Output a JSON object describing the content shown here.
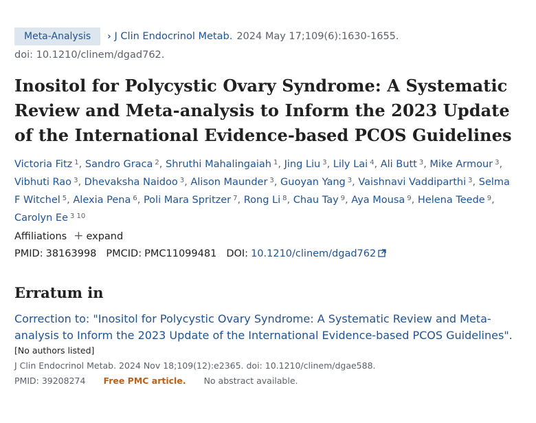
{
  "header": {
    "publication_type": "Meta-Analysis",
    "journal": "J Clin Endocrinol Metab.",
    "citation": "2024 May 17;109(6):1630-1655.",
    "doi": "doi: 10.1210/clinem/dgad762."
  },
  "title": "Inositol for Polycystic Ovary Syndrome: A Systematic Review and Meta-analysis to Inform the 2023 Update of the International Evidence-based PCOS Guidelines",
  "authors": [
    {
      "name": "Victoria Fitz",
      "aff": "1"
    },
    {
      "name": "Sandro Graca",
      "aff": "2"
    },
    {
      "name": "Shruthi Mahalingaiah",
      "aff": "1"
    },
    {
      "name": "Jing Liu",
      "aff": "3"
    },
    {
      "name": "Lily Lai",
      "aff": "4"
    },
    {
      "name": "Ali Butt",
      "aff": "3"
    },
    {
      "name": "Mike Armour",
      "aff": "3"
    },
    {
      "name": "Vibhuti Rao",
      "aff": "3"
    },
    {
      "name": "Dhevaksha Naidoo",
      "aff": "3"
    },
    {
      "name": "Alison Maunder",
      "aff": "3"
    },
    {
      "name": "Guoyan Yang",
      "aff": "3"
    },
    {
      "name": "Vaishnavi Vaddiparthi",
      "aff": "3"
    },
    {
      "name": "Selma F Witchel",
      "aff": "5"
    },
    {
      "name": "Alexia Pena",
      "aff": "6"
    },
    {
      "name": "Poli Mara Spritzer",
      "aff": "7"
    },
    {
      "name": "Rong Li",
      "aff": "8"
    },
    {
      "name": "Chau Tay",
      "aff": "9"
    },
    {
      "name": "Aya Mousa",
      "aff": "9"
    },
    {
      "name": "Helena Teede",
      "aff": "9"
    },
    {
      "name": "Carolyn Ee",
      "aff": "3 10"
    }
  ],
  "affiliations": {
    "label": "Affiliations",
    "expand": "expand"
  },
  "identifiers": {
    "pmid_label": "PMID:",
    "pmid": "38163998",
    "pmcid_label": "PMCID:",
    "pmcid": "PMC11099481",
    "doi_label": "DOI:",
    "doi": "10.1210/clinem/dgad762"
  },
  "erratum": {
    "heading": "Erratum in",
    "link": "Correction to: \"Inositol for Polycystic Ovary Syndrome: A Systematic Review and Meta-analysis to Inform the 2023 Update of the International Evidence-based PCOS Guidelines\".",
    "no_authors": "[No authors listed]",
    "citation": "J Clin Endocrinol Metab. 2024 Nov 18;109(12):e2365. doi: 10.1210/clinem/dgae588.",
    "pmid": "PMID: 39208274",
    "free_pmc": "Free PMC article.",
    "no_abstract": "No abstract available."
  },
  "colors": {
    "link": "#205493",
    "muted": "#5b616b",
    "badge_bg": "#dde5ef",
    "free": "#b8621b"
  },
  "icons": [
    "chevron-right-icon",
    "plus-icon",
    "external-link-icon"
  ]
}
